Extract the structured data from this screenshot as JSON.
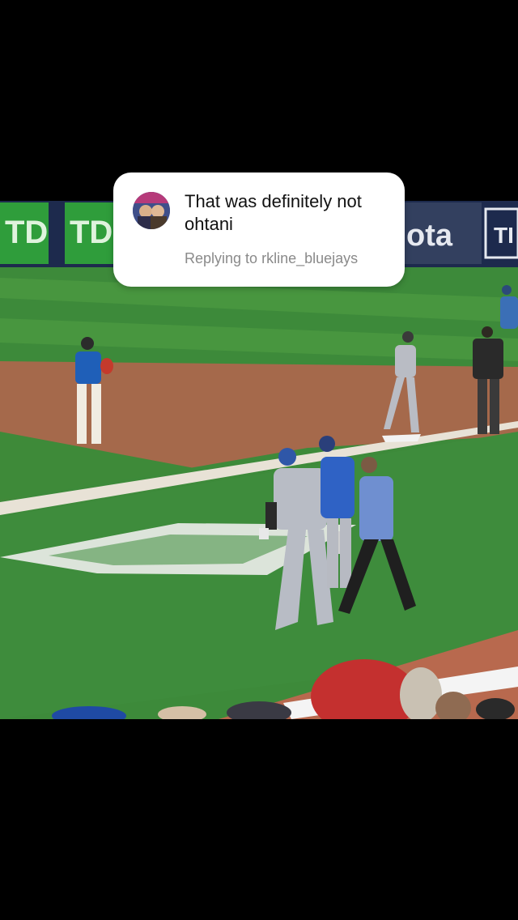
{
  "reply_card": {
    "comment": "That was definitely not ohtani",
    "replying_prefix": "Replying to",
    "replying_handle": "rkline_bluejays"
  },
  "video": {
    "description_icons": [
      "avatar-icon"
    ],
    "ad_board_left": "TD",
    "ad_board_left2": "TD",
    "ad_board_right": "ota",
    "ad_board_right2": "TI"
  },
  "colors": {
    "card_bg": "#ffffff",
    "card_text": "#111111",
    "muted_text": "#8a8a8a",
    "field_green": "#3f8a3c",
    "dirt": "#a86a4a",
    "td_green": "#2e9a3a"
  }
}
